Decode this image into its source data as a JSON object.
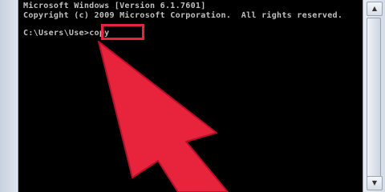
{
  "console": {
    "lines": [
      "Microsoft Windows [Version 6.1.7601]",
      "Copyright (c) 2009 Microsoft Corporation.  All rights reserved."
    ],
    "prompt_path": "C:\\Users\\Use",
    "prompt_separator": ">",
    "command": "copy"
  },
  "scrollbar": {
    "up_icon": "scroll-up-arrow-icon",
    "down_icon": "scroll-down-arrow-icon"
  },
  "annotation": {
    "arrow_color": "#e8243c",
    "highlight_color": "#e8243c",
    "console_bg": "#000000",
    "console_text": "#c0c0c0"
  }
}
